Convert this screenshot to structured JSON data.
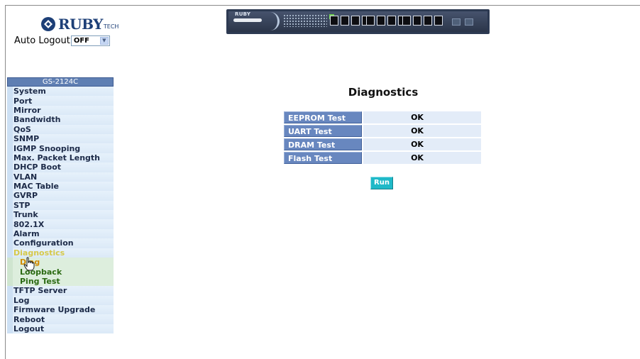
{
  "brand": {
    "name": "RUBY",
    "suffix": "TECH"
  },
  "auto_logout": {
    "label": "Auto Logout",
    "value": "OFF"
  },
  "device": {
    "brand_text": "RUBY",
    "port_groups": [
      4,
      4,
      4
    ]
  },
  "sidebar": {
    "title": "GS-2124C",
    "items": [
      "System",
      "Port",
      "Mirror",
      "Bandwidth",
      "QoS",
      "SNMP",
      "IGMP Snooping",
      "Max. Packet Length",
      "DHCP Boot",
      "VLAN",
      "MAC Table",
      "GVRP",
      "STP",
      "Trunk",
      "802.1X",
      "Alarm",
      "Configuration",
      "Diagnostics"
    ],
    "active": "Diagnostics",
    "sub_items": [
      "Diag",
      "Loopback",
      "Ping Test"
    ],
    "current_sub": "Diag",
    "items_after": [
      "TFTP Server",
      "Log",
      "Firmware Upgrade",
      "Reboot",
      "Logout"
    ]
  },
  "main": {
    "title": "Diagnostics",
    "tests": [
      {
        "label": "EEPROM Test",
        "result": "OK"
      },
      {
        "label": "UART Test",
        "result": "OK"
      },
      {
        "label": "DRAM Test",
        "result": "OK"
      },
      {
        "label": "Flash Test",
        "result": "OK"
      }
    ],
    "run_label": "Run"
  },
  "colors": {
    "header_blue": "#6887bf",
    "cell_bg": "#e3ecf8",
    "run_button": "#1fb9c8",
    "active_menu": "#d6c94a",
    "sub_menu_text": "#2b6a12"
  }
}
